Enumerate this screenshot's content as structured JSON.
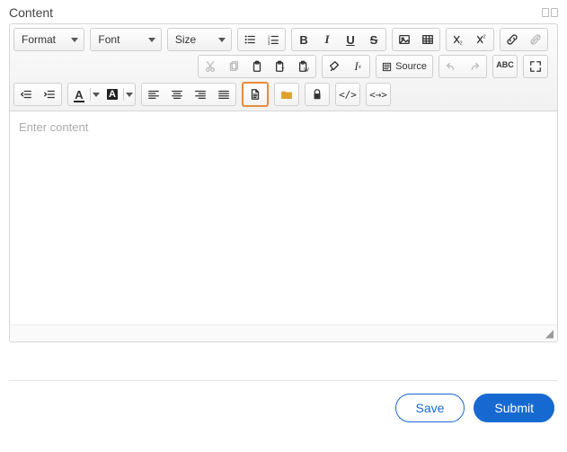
{
  "panel": {
    "title": "Content"
  },
  "toolbar": {
    "format_label": "Format",
    "font_label": "Font",
    "size_label": "Size",
    "source_label": "Source"
  },
  "icons": {
    "bold": "B",
    "italic": "I",
    "underline": "U",
    "strike": "S",
    "letter_a": "A"
  },
  "editor": {
    "placeholder": "Enter content",
    "value": ""
  },
  "footer": {
    "save_label": "Save",
    "submit_label": "Submit"
  }
}
